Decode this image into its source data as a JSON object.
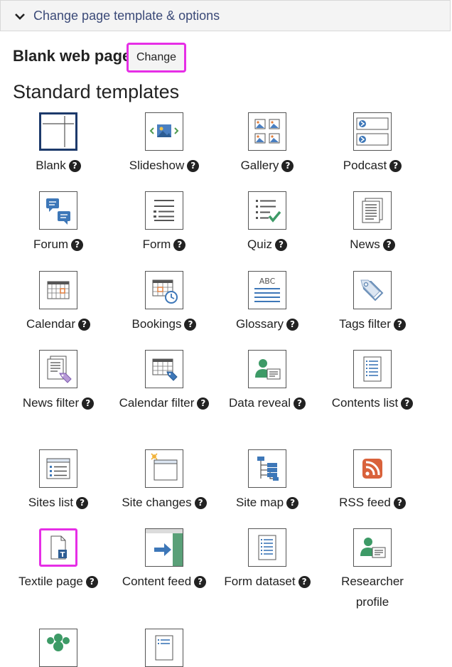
{
  "header": {
    "title": "Change page template & options"
  },
  "current_template": {
    "name": "Blank web page",
    "change_label": "Change"
  },
  "section_title": "Standard templates",
  "help_glyph": "?",
  "templates": [
    {
      "label": "Blank",
      "icon": "blank-template-icon"
    },
    {
      "label": "Slideshow",
      "icon": "slideshow-icon"
    },
    {
      "label": "Gallery",
      "icon": "gallery-icon"
    },
    {
      "label": "Podcast",
      "icon": "podcast-icon"
    },
    {
      "label": "Forum",
      "icon": "forum-icon"
    },
    {
      "label": "Form",
      "icon": "form-icon"
    },
    {
      "label": "Quiz",
      "icon": "quiz-icon"
    },
    {
      "label": "News",
      "icon": "news-icon"
    },
    {
      "label": "Calendar",
      "icon": "calendar-icon"
    },
    {
      "label": "Bookings",
      "icon": "bookings-icon"
    },
    {
      "label": "Glossary",
      "icon": "glossary-icon"
    },
    {
      "label": "Tags filter",
      "icon": "tags-filter-icon"
    },
    {
      "label": "News filter",
      "icon": "news-filter-icon"
    },
    {
      "label": "Calendar filter",
      "icon": "calendar-filter-icon"
    },
    {
      "label": "Data reveal",
      "icon": "data-reveal-icon"
    },
    {
      "label": "Contents list",
      "icon": "contents-list-icon"
    },
    {
      "label": "Sites list",
      "icon": "sites-list-icon"
    },
    {
      "label": "Site changes",
      "icon": "site-changes-icon"
    },
    {
      "label": "Site map",
      "icon": "site-map-icon"
    },
    {
      "label": "RSS feed",
      "icon": "rss-feed-icon"
    },
    {
      "label": "Textile page",
      "icon": "textile-page-icon"
    },
    {
      "label": "Content feed",
      "icon": "content-feed-icon"
    },
    {
      "label": "Form dataset",
      "icon": "form-dataset-icon"
    },
    {
      "label": "Researcher profile",
      "icon": "researcher-profile-icon"
    }
  ],
  "colors": {
    "header_text": "#3b4a78",
    "highlight": "#e62ee6",
    "selected": "#1d3a6b",
    "rss": "#d9623b"
  }
}
